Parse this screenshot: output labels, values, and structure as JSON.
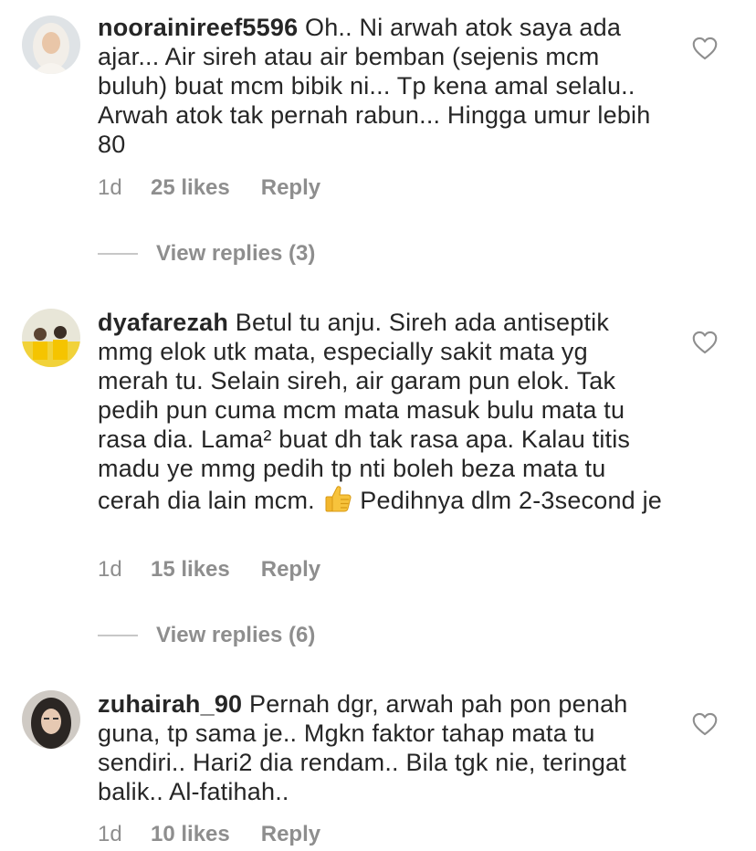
{
  "comments": [
    {
      "username": "noorainireef5596",
      "text": "Oh.. Ni arwah atok saya ada ajar... Air sireh atau air bemban (sejenis mcm buluh) buat mcm bibik ni... Tp kena amal selalu.. Arwah atok tak pernah rabun... Hingga umur lebih 80",
      "time": "1d",
      "likes": "25 likes",
      "reply": "Reply",
      "view_replies": "View replies (3)"
    },
    {
      "username": "dyafarezah",
      "text": "Betul tu anju. Sireh ada antiseptik mmg elok utk mata, especially sakit mata yg merah tu. Selain sireh, air garam pun elok. Tak pedih pun cuma mcm mata masuk bulu mata tu rasa dia. Lama² buat dh tak rasa apa. Kalau titis madu ye mmg pedih tp nti boleh beza mata tu cerah dia lain mcm.",
      "text_after_emoji": "Pedihnya dlm 2-3second je",
      "emoji": "thumbs-up",
      "time": "1d",
      "likes": "15 likes",
      "reply": "Reply",
      "view_replies": "View replies (6)"
    },
    {
      "username": "zuhairah_90",
      "text": "Pernah dgr, arwah pah pon penah guna, tp sama je.. Mgkn faktor tahap mata tu sendiri.. Hari2 dia rendam.. Bila tgk nie, teringat balik.. Al-fatihah..",
      "time": "1d",
      "likes": "10 likes",
      "reply": "Reply"
    }
  ],
  "icons": {
    "like": "heart-outline-icon",
    "emoji": "thumbs-up-emoji-icon"
  },
  "colors": {
    "text": "#262626",
    "secondary": "#8e8e8e",
    "divider": "#c7c7c7"
  }
}
